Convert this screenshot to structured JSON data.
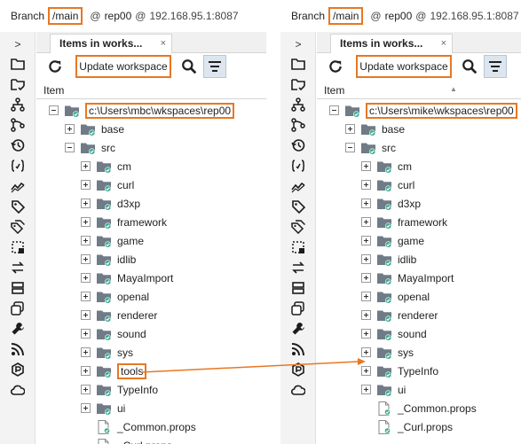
{
  "left_panel": {
    "branch": {
      "label": "Branch",
      "name": "/main",
      "at1": "@",
      "repo": "rep00",
      "at2": "@",
      "server": "192.168.95.1:8087"
    },
    "rail_expand": ">",
    "tab": {
      "title": "Items in works...",
      "close": "×"
    },
    "toolbar": {
      "update_label": "Update workspace"
    },
    "column_header": "Item",
    "tree": {
      "root": "c:\\Users\\mbc\\wkspaces\\rep00",
      "rows": [
        "base",
        "src",
        "cm",
        "curl",
        "d3xp",
        "framework",
        "game",
        "idlib",
        "MayaImport",
        "openal",
        "renderer",
        "sound",
        "sys",
        "tools",
        "TypeInfo",
        "ui",
        "_Common.props",
        "_Curl.props"
      ]
    }
  },
  "right_panel": {
    "branch": {
      "label": "Branch",
      "name": "/main",
      "at1": "@",
      "repo": "rep00",
      "at2": "@",
      "server": "192.168.95.1:8087"
    },
    "rail_expand": ">",
    "tab": {
      "title": "Items in works...",
      "close": "×"
    },
    "toolbar": {
      "update_label": "Update workspace"
    },
    "column_header": "Item",
    "tree": {
      "root": "c:\\Users\\mike\\wkspaces\\rep00",
      "rows": [
        "base",
        "src",
        "cm",
        "curl",
        "d3xp",
        "framework",
        "game",
        "idlib",
        "MayaImport",
        "openal",
        "renderer",
        "sound",
        "sys",
        "TypeInfo",
        "ui",
        "_Common.props",
        "_Curl.props"
      ]
    }
  },
  "rail_icons": [
    "folder-icon",
    "folder-check-icon",
    "branch-explorer-icon",
    "branches-icon",
    "history-icon",
    "code-review-icon",
    "chart-icon",
    "label-icon",
    "labels-icon",
    "changes-icon",
    "sync-icon",
    "server-icon",
    "shelves-icon",
    "wrench-icon",
    "rss-icon",
    "plastic-icon",
    "cloud-icon"
  ],
  "colors": {
    "highlight": "#e87722",
    "folder": "#6f7b86",
    "check": "#3aaa8c",
    "accent_blue": "#1e6fb5"
  }
}
